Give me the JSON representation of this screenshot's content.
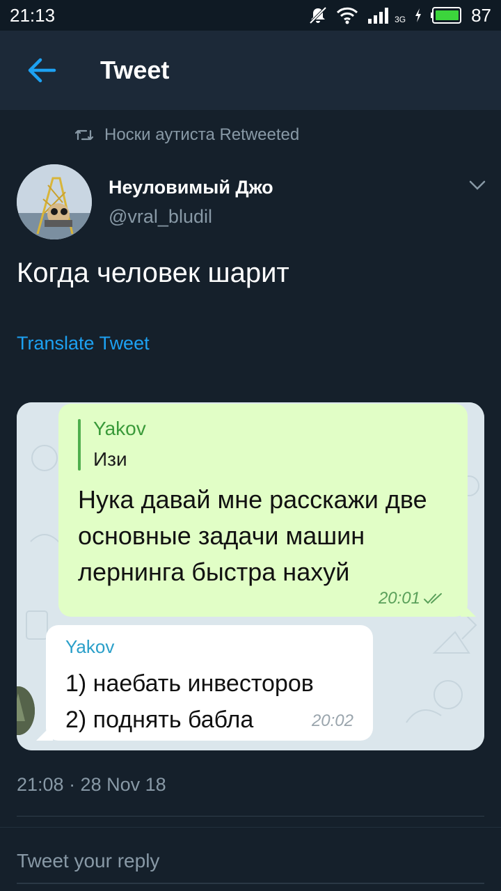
{
  "status_bar": {
    "time": "21:13",
    "network": "3G",
    "battery": "87",
    "icons": [
      "mute-icon",
      "wifi-icon",
      "signal-icon",
      "charging-icon",
      "battery-icon"
    ]
  },
  "appbar": {
    "title": "Tweet",
    "back_icon": "arrow-left-icon"
  },
  "retweet": {
    "icon": "retweet-icon",
    "text": "Носки аутиста Retweeted"
  },
  "author": {
    "name": "Неуловимый Джо",
    "handle": "@vral_bludil",
    "menu_icon": "chevron-down-icon"
  },
  "tweet": {
    "text": "Когда человек шарит",
    "translate_label": "Translate Tweet",
    "timestamp": "21:08 · 28 Nov 18"
  },
  "media": {
    "outgoing": {
      "quote_name": "Yakov",
      "quote_text": "Изи",
      "text": "Нука давай мне расскажи две основные задачи машин лернинга быстра нахуй",
      "time": "20:01"
    },
    "incoming": {
      "name": "Yakov",
      "line1": "1) наебать инвесторов",
      "line2": "2) поднять бабла",
      "time": "20:02"
    }
  },
  "reply": {
    "placeholder": "Tweet your reply"
  },
  "colors": {
    "background": "#15202b",
    "appbar": "#1c2938",
    "accent": "#1da1f2",
    "secondary_text": "#8899a6",
    "bubble_out": "#e1fec6"
  }
}
